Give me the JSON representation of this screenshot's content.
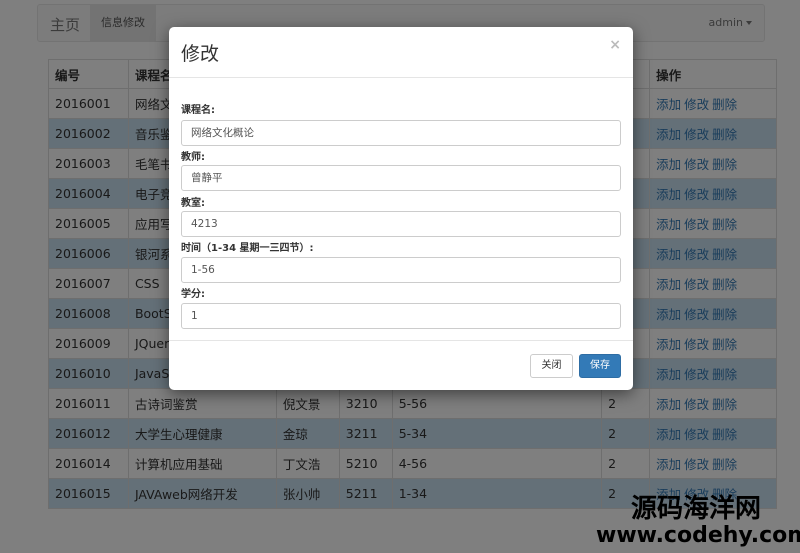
{
  "navbar": {
    "brand": "主页",
    "active_tab": "信息修改",
    "user": "admin"
  },
  "table": {
    "headers": [
      "编号",
      "课程名",
      "",
      "",
      "",
      "",
      "操作"
    ],
    "rows": [
      [
        "2016001",
        "网络文",
        "",
        "",
        "",
        ""
      ],
      [
        "2016002",
        "音乐鉴",
        "",
        "",
        "",
        ""
      ],
      [
        "2016003",
        "毛笔书",
        "",
        "",
        "",
        ""
      ],
      [
        "2016004",
        "电子竞",
        "",
        "",
        "",
        ""
      ],
      [
        "2016005",
        "应用写",
        "",
        "",
        "",
        ""
      ],
      [
        "2016006",
        "银河系",
        "",
        "",
        "",
        ""
      ],
      [
        "2016007",
        "CSS",
        "",
        "",
        "",
        ""
      ],
      [
        "2016008",
        "BootS",
        "",
        "",
        "",
        ""
      ],
      [
        "2016009",
        "JQuer",
        "",
        "",
        "",
        ""
      ],
      [
        "2016010",
        "JavaS",
        "",
        "",
        "",
        ""
      ],
      [
        "2016011",
        "古诗词鉴赏",
        "倪文景",
        "3210",
        "5-56",
        "2"
      ],
      [
        "2016012",
        "大学生心理健康",
        "金琼",
        "3211",
        "5-34",
        "2"
      ],
      [
        "2016014",
        "计算机应用基础",
        "丁文浩",
        "5210",
        "4-56",
        "2"
      ],
      [
        "2016015",
        "JAVAweb网络开发",
        "张小帅",
        "5211",
        "1-34",
        "2"
      ]
    ],
    "actions": {
      "add": "添加",
      "edit": "修改",
      "delete": "删除"
    }
  },
  "modal": {
    "title": "修改",
    "close": "×",
    "fields": {
      "course": {
        "label": "课程名:",
        "value": "网络文化概论"
      },
      "teacher": {
        "label": "教师:",
        "value": "曾静平"
      },
      "room": {
        "label": "教室:",
        "value": "4213"
      },
      "time": {
        "label": "时间（1-34 星期一三四节）:",
        "value": "1-56"
      },
      "credit": {
        "label": "学分:",
        "value": "1"
      }
    },
    "close_button": "关闭",
    "save_button": "保存"
  },
  "watermark": {
    "line1": "源码海洋网",
    "line2": "www.codehy.com"
  }
}
